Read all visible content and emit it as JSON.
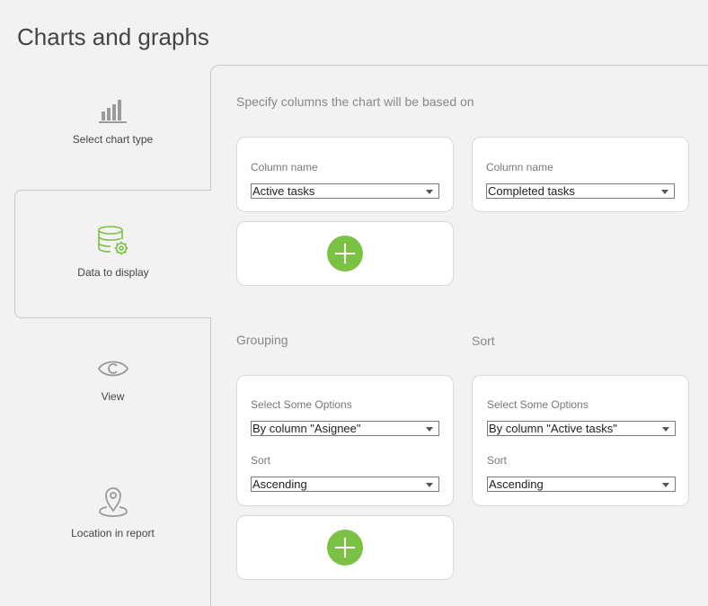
{
  "page": {
    "title": "Charts and graphs"
  },
  "steps": [
    {
      "label": "Select chart type",
      "icon": "bar-chart-icon"
    },
    {
      "label": "Data to display",
      "icon": "database-gear-icon",
      "active": true
    },
    {
      "label": "View",
      "icon": "eye-icon"
    },
    {
      "label": "Location in report",
      "icon": "location-pin-icon"
    }
  ],
  "columns": {
    "heading": "Specify columns the chart will be based on",
    "items": [
      {
        "label": "Column name",
        "value": "Active tasks"
      },
      {
        "label": "Column name",
        "value": "Completed tasks"
      }
    ]
  },
  "grouping": {
    "heading": "Grouping",
    "options_label": "Select Some Options",
    "option_value": "By column \"Asignee\"",
    "sort_label": "Sort",
    "sort_value": "Ascending"
  },
  "sort": {
    "heading": "Sort",
    "options_label": "Select Some Options",
    "option_value": "By column \"Active tasks\"",
    "sort_label": "Sort",
    "sort_value": "Ascending"
  },
  "colors": {
    "accent_green": "#7cc143",
    "background": "#f2f2f2",
    "card": "#ffffff",
    "border": "#c9c9c9"
  }
}
